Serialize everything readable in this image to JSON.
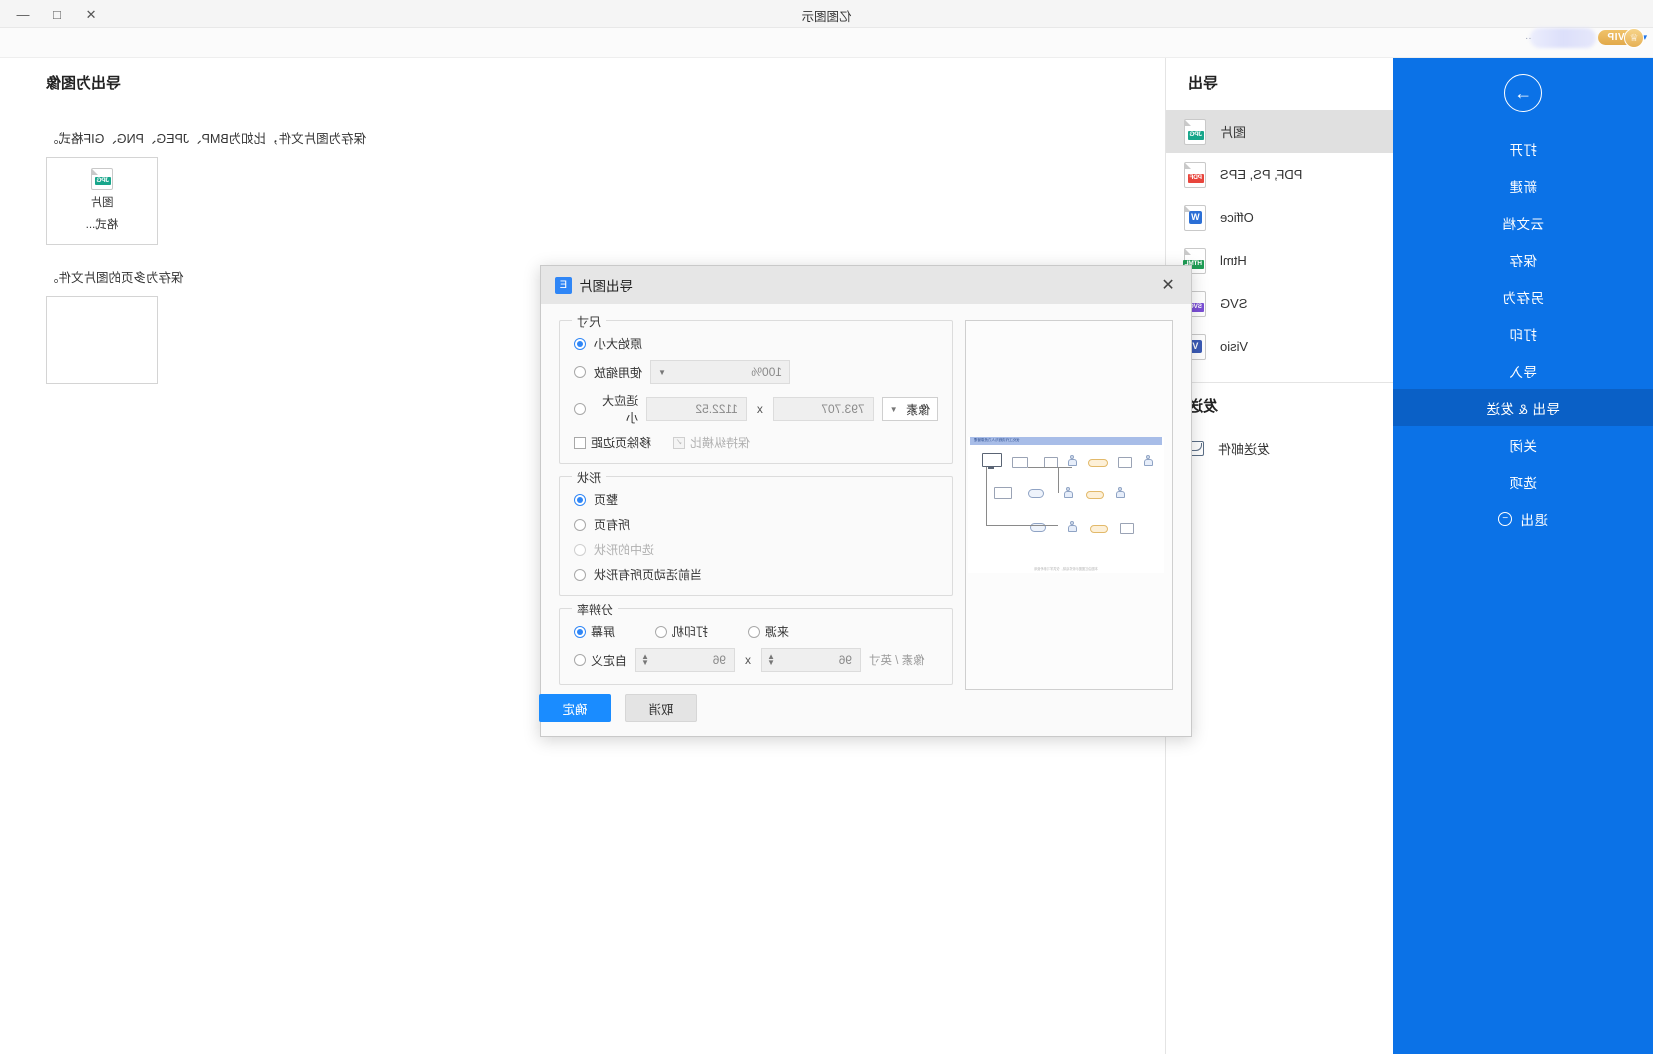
{
  "window": {
    "title": "亿图图示",
    "minimize_label": "—",
    "maximize_label": "□",
    "close_label": "✕",
    "vip_label": "VIP",
    "vip_caret": "▾",
    "user_dots": "··"
  },
  "sidebar": {
    "back_icon": "→",
    "items": [
      {
        "label": "打开",
        "active": false
      },
      {
        "label": "新建",
        "active": false
      },
      {
        "label": "云文档",
        "active": false
      },
      {
        "label": "保存",
        "active": false
      },
      {
        "label": "另存为",
        "active": false
      },
      {
        "label": "打印",
        "active": false
      },
      {
        "label": "导入",
        "active": false
      },
      {
        "label": "导出 & 发送",
        "active": true
      },
      {
        "label": "关闭",
        "active": false
      },
      {
        "label": "选项",
        "active": false
      },
      {
        "label": "退出",
        "active": false,
        "icon": "−"
      }
    ]
  },
  "export_panel": {
    "heading": "导出",
    "items": [
      {
        "label": "图片",
        "tag": "JPG",
        "tag_color": "#18a68b",
        "selected": true
      },
      {
        "label": "PDF, PS, EPS",
        "tag": "PDF",
        "tag_color": "#e8453c",
        "selected": false
      },
      {
        "label": "Office",
        "tag": "W",
        "tag_color": "#2b6fd6",
        "selected": false,
        "square": true
      },
      {
        "label": "Html",
        "tag": "HTML",
        "tag_color": "#1f9d55",
        "selected": false
      },
      {
        "label": "SVG",
        "tag": "SVG",
        "tag_color": "#7b4fd6",
        "selected": false
      },
      {
        "label": "Visio",
        "tag": "V",
        "tag_color": "#3b5bb5",
        "selected": false,
        "square": true
      }
    ],
    "send_heading": "发送",
    "send_items": [
      {
        "label": "发送邮件",
        "icon": "mail-icon"
      }
    ]
  },
  "detail": {
    "title": "导出为图像",
    "desc_single": "保存为图片文件，比如为BMP、JPEG、PNG、GIF格式。",
    "card_single": {
      "tag": "JPG",
      "line1": "图片",
      "line2": "格式..."
    },
    "desc_multi": "保存为多页的图片文件。"
  },
  "dialog": {
    "title": "导出图片",
    "logo_glyph": "E",
    "close_glyph": "✕",
    "size": {
      "legend": "尺寸",
      "original_label": "原始大小",
      "original_selected": true,
      "scale_label": "使用缩放",
      "scale_selected": false,
      "scale_value": "100%",
      "fit_label": "适应大小",
      "fit_selected": false,
      "width_value": "1122.52",
      "height_value": "793.707",
      "x_sep": "x",
      "unit_value": "像素",
      "border_checkbox_label": "移除页边距",
      "border_checked": false,
      "ratio_checkbox_label": "保持纵横比",
      "ratio_checked": true,
      "ratio_mark": "✓"
    },
    "shape": {
      "legend": "形状",
      "options": [
        {
          "label": "整页",
          "selected": true,
          "disabled": false
        },
        {
          "label": "所有页",
          "selected": false,
          "disabled": false
        },
        {
          "label": "选中的形状",
          "selected": false,
          "disabled": true
        },
        {
          "label": "当前活动页所有形状",
          "selected": false,
          "disabled": false
        }
      ]
    },
    "resolution": {
      "legend": "分辨率",
      "options": [
        {
          "label": "屏幕",
          "selected": true
        },
        {
          "label": "打印机",
          "selected": false
        },
        {
          "label": "来源",
          "selected": false
        },
        {
          "label": "自定义",
          "selected": false
        }
      ],
      "dpi_x": "96",
      "dpi_y": "96",
      "x_sep": "x",
      "unit_note": "像素 / 英寸"
    },
    "preview": {
      "banner_caption": "优化工作流程与人力资源管理",
      "footer_caption": "本图由亿图图示软件绘制，仅供学习参考使用"
    },
    "buttons": {
      "ok": "确定",
      "cancel": "取消"
    }
  }
}
